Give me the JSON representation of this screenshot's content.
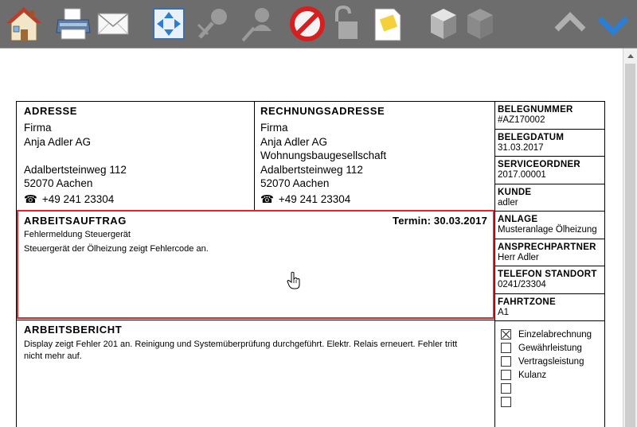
{
  "toolbar": {
    "buttons": [
      {
        "name": "home-button",
        "icon": "house-icon"
      },
      {
        "name": "print-button",
        "icon": "printer-icon"
      },
      {
        "name": "mail-button",
        "icon": "envelope-icon"
      },
      {
        "name": "fit-button",
        "icon": "expand-arrows-icon"
      },
      {
        "name": "unlink-button",
        "icon": "unlink-pin-icon"
      },
      {
        "name": "user-pin-button",
        "icon": "pin-person-icon"
      },
      {
        "name": "cancel-button",
        "icon": "prohibited-icon"
      },
      {
        "name": "unlock-button",
        "icon": "padlock-open-icon"
      },
      {
        "name": "note-button",
        "icon": "sticky-note-icon"
      },
      {
        "name": "cube-button",
        "icon": "cube-icon"
      },
      {
        "name": "cube-disabled-button",
        "icon": "cube-faded-icon"
      },
      {
        "name": "previous-button",
        "icon": "chevron-up-icon"
      },
      {
        "name": "next-button",
        "icon": "chevron-down-icon"
      }
    ]
  },
  "address": {
    "title": "ADRESSE",
    "line1": "Firma",
    "line2": "Anja Adler AG",
    "line3": "",
    "street": "Adalbertsteinweg 112",
    "city": "52070 Aachen",
    "phone": "+49 241 23304"
  },
  "billing_address": {
    "title": "RECHNUNGSADRESSE",
    "line1": "Firma",
    "line2": "Anja Adler AG",
    "line3": "Wohnungsbaugesellschaft",
    "street": "Adalbertsteinweg 112",
    "city": "52070 Aachen",
    "phone": "+49 241 23304"
  },
  "work_order": {
    "title": "ARBEITSAUFTRAG",
    "deadline": "Termin: 30.03.2017",
    "line1": "Fehlermeldung Steuergerät",
    "line2": "Steuergerät der Ölheizung zeigt Fehlercode an."
  },
  "work_report": {
    "title": "ARBEITSBERICHT",
    "text": "Display zeigt Fehler 201 an. Reinigung und Systemüberprüfung durchgeführt. Elektr. Relais erneuert. Fehler tritt nicht mehr auf."
  },
  "sidebar": {
    "fields": [
      {
        "label": "BELEGNUMMER",
        "value": "#AZ170002"
      },
      {
        "label": "BELEGDATUM",
        "value": "31.03.2017"
      },
      {
        "label": "SERVICEORDNER",
        "value": "2017.00001"
      },
      {
        "label": "KUNDE",
        "value": "adler"
      },
      {
        "label": "ANLAGE",
        "value": "Musteranlage Ölheizung"
      },
      {
        "label": "ANSPRECHPARTNER",
        "value": "Herr Adler"
      },
      {
        "label": "TELEFON STANDORT",
        "value": "0241/23304"
      },
      {
        "label": "FAHRTZONE",
        "value": "A1"
      }
    ],
    "billing_options": [
      {
        "label": "Einzelabrechnung",
        "checked": true
      },
      {
        "label": "Gewährleistung",
        "checked": false
      },
      {
        "label": "Vertragsleistung",
        "checked": false
      },
      {
        "label": "Kulanz",
        "checked": false
      },
      {
        "label": "",
        "checked": false
      },
      {
        "label": "",
        "checked": false
      }
    ]
  },
  "colors": {
    "toolbar_bg": "#6d6d6d",
    "highlight": "#e0262b",
    "accent_blue": "#2a7fd4"
  }
}
